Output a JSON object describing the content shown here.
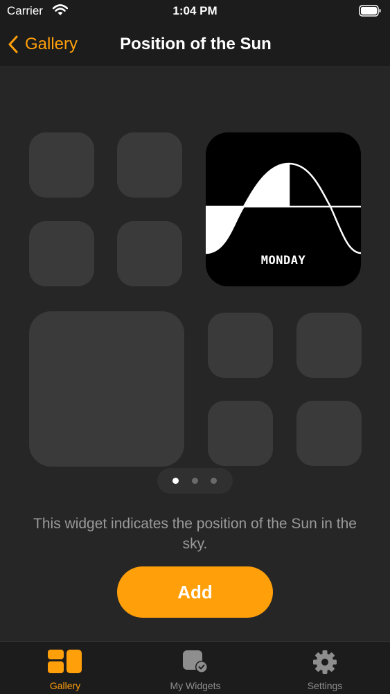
{
  "status_bar": {
    "carrier": "Carrier",
    "time": "1:04 PM"
  },
  "nav": {
    "back_label": "Gallery",
    "title": "Position of the Sun"
  },
  "widget": {
    "day_label": "MONDAY"
  },
  "pager": {
    "page_count": 3,
    "current_page": 1
  },
  "description": "This widget indicates the position of the Sun in the sky.",
  "add_button_label": "Add",
  "tabs": [
    {
      "label": "Gallery",
      "icon": "gallery-icon",
      "selected": true
    },
    {
      "label": "My Widgets",
      "icon": "my-widgets-icon",
      "selected": false
    },
    {
      "label": "Settings",
      "icon": "gear-icon",
      "selected": false
    }
  ],
  "colors": {
    "accent": "#ff9f0a",
    "background": "#262626",
    "bar": "#1c1c1c",
    "tile": "#3a3a3a"
  }
}
